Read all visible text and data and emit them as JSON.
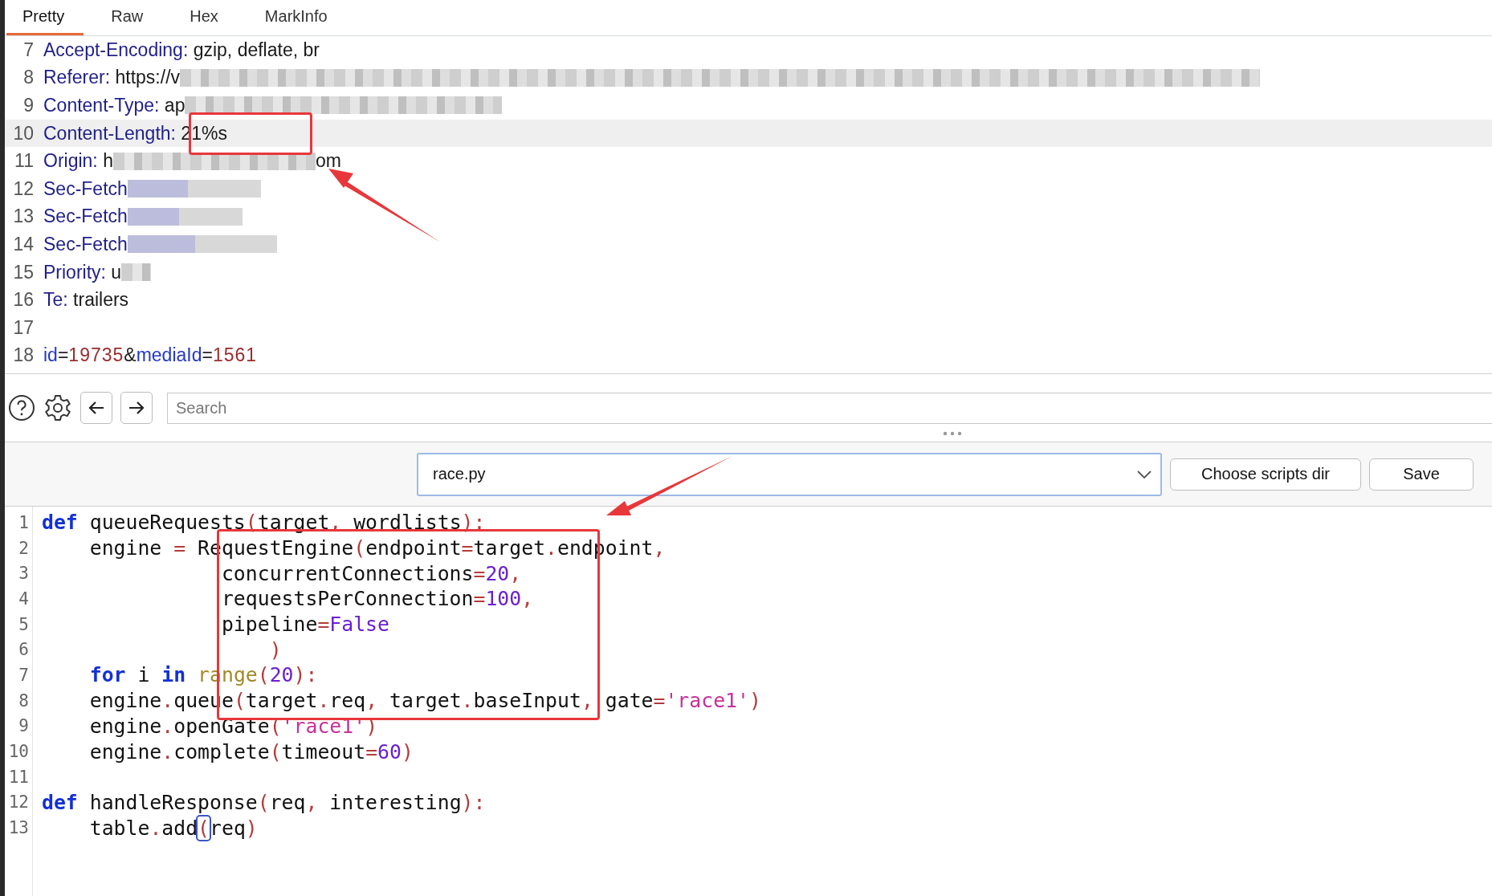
{
  "tabs": [
    {
      "label": "Pretty",
      "selected": true
    },
    {
      "label": "Raw",
      "selected": false
    },
    {
      "label": "Hex",
      "selected": false
    },
    {
      "label": "MarkInfo",
      "selected": false
    }
  ],
  "request_lines": [
    {
      "number": "7",
      "key": "Accept-Encoding:",
      "value": "gzip, deflate, br",
      "blurred": false,
      "highlighted": false
    },
    {
      "number": "8",
      "key": "Referer:",
      "value": "https://v",
      "blurred": true,
      "highlighted": false
    },
    {
      "number": "9",
      "key": "Content-Type:",
      "value": "ap",
      "blurred": true,
      "highlighted": false
    },
    {
      "number": "10",
      "key": "Content-Length:",
      "value": "21%s",
      "blurred": false,
      "highlighted": true
    },
    {
      "number": "11",
      "key": "Origin:",
      "value": "h",
      "blurred": true,
      "tail": "om",
      "highlighted": false
    },
    {
      "number": "12",
      "key": "Sec-Fetch",
      "blurred": true,
      "highlighted": false
    },
    {
      "number": "13",
      "key": "Sec-Fetch",
      "blurred": true,
      "highlighted": false
    },
    {
      "number": "14",
      "key": "Sec-Fetch",
      "blurred": true,
      "highlighted": false
    },
    {
      "number": "15",
      "key": "Priority:",
      "value": "u",
      "blurred": true,
      "highlighted": false
    },
    {
      "number": "16",
      "key": "Te:",
      "value": "trailers",
      "blurred": false,
      "highlighted": false
    },
    {
      "number": "17",
      "blurred": false,
      "highlighted": false
    }
  ],
  "body_line": {
    "number": "18",
    "parts": [
      {
        "kind": "param",
        "text": "id"
      },
      {
        "kind": "op",
        "text": "="
      },
      {
        "kind": "value",
        "text": "19735"
      },
      {
        "kind": "op",
        "text": "&"
      },
      {
        "kind": "param",
        "text": "mediaId"
      },
      {
        "kind": "op",
        "text": "="
      },
      {
        "kind": "value",
        "text": "1561"
      }
    ]
  },
  "search": {
    "placeholder": "Search"
  },
  "script": {
    "value": "race.py"
  },
  "buttons": [
    "Choose scripts dir",
    "Save"
  ],
  "code_lines": [
    {
      "number": "1",
      "parts": [
        {
          "kind": "kw",
          "text": "def"
        },
        {
          "kind": "name",
          "text": " queueRequests"
        },
        {
          "kind": "op",
          "text": "("
        },
        {
          "kind": "name",
          "text": "target"
        },
        {
          "kind": "op",
          "text": ","
        },
        {
          "kind": "name",
          "text": " wordlists"
        },
        {
          "kind": "op",
          "text": ")"
        },
        {
          "kind": "op",
          "text": ":"
        }
      ]
    },
    {
      "number": "2",
      "parts": [
        {
          "kind": "name",
          "text": "    engine "
        },
        {
          "kind": "op",
          "text": "="
        },
        {
          "kind": "name",
          "text": " RequestEngine"
        },
        {
          "kind": "op",
          "text": "("
        },
        {
          "kind": "name",
          "text": "endpoint"
        },
        {
          "kind": "op",
          "text": "="
        },
        {
          "kind": "name",
          "text": "target"
        },
        {
          "kind": "op",
          "text": "."
        },
        {
          "kind": "name",
          "text": "endpoint"
        },
        {
          "kind": "op",
          "text": ","
        }
      ]
    },
    {
      "number": "3",
      "parts": [
        {
          "kind": "name",
          "text": "               concurrentConnections"
        },
        {
          "kind": "op",
          "text": "="
        },
        {
          "kind": "num",
          "text": "20"
        },
        {
          "kind": "op",
          "text": ","
        }
      ]
    },
    {
      "number": "4",
      "parts": [
        {
          "kind": "name",
          "text": "               requestsPerConnection"
        },
        {
          "kind": "op",
          "text": "="
        },
        {
          "kind": "num",
          "text": "100"
        },
        {
          "kind": "op",
          "text": ","
        }
      ]
    },
    {
      "number": "5",
      "parts": [
        {
          "kind": "name",
          "text": "               pipeline"
        },
        {
          "kind": "op",
          "text": "="
        },
        {
          "kind": "const",
          "text": "False"
        }
      ]
    },
    {
      "number": "6",
      "parts": [
        {
          "kind": "op",
          "text": "                   )"
        }
      ]
    },
    {
      "number": "7",
      "parts": [
        {
          "kind": "kw",
          "text": "    for"
        },
        {
          "kind": "name",
          "text": " i "
        },
        {
          "kind": "kw",
          "text": "in"
        },
        {
          "kind": "builtin",
          "text": " range"
        },
        {
          "kind": "op",
          "text": "("
        },
        {
          "kind": "num",
          "text": "20"
        },
        {
          "kind": "op",
          "text": ")"
        },
        {
          "kind": "op",
          "text": ":"
        }
      ]
    },
    {
      "number": "8",
      "parts": [
        {
          "kind": "name",
          "text": "    engine"
        },
        {
          "kind": "op",
          "text": "."
        },
        {
          "kind": "name",
          "text": "queue"
        },
        {
          "kind": "op",
          "text": "("
        },
        {
          "kind": "name",
          "text": "target"
        },
        {
          "kind": "op",
          "text": "."
        },
        {
          "kind": "name",
          "text": "req"
        },
        {
          "kind": "op",
          "text": ","
        },
        {
          "kind": "name",
          "text": " target"
        },
        {
          "kind": "op",
          "text": "."
        },
        {
          "kind": "name",
          "text": "baseInput"
        },
        {
          "kind": "op",
          "text": ","
        },
        {
          "kind": "name",
          "text": " gate"
        },
        {
          "kind": "op",
          "text": "="
        },
        {
          "kind": "str",
          "text": "'race1'"
        },
        {
          "kind": "op",
          "text": ")"
        }
      ]
    },
    {
      "number": "9",
      "parts": [
        {
          "kind": "name",
          "text": "    engine"
        },
        {
          "kind": "op",
          "text": "."
        },
        {
          "kind": "name",
          "text": "openGate"
        },
        {
          "kind": "op",
          "text": "("
        },
        {
          "kind": "str",
          "text": "'race1'"
        },
        {
          "kind": "op",
          "text": ")"
        }
      ]
    },
    {
      "number": "10",
      "parts": [
        {
          "kind": "name",
          "text": "    engine"
        },
        {
          "kind": "op",
          "text": "."
        },
        {
          "kind": "name",
          "text": "complete"
        },
        {
          "kind": "op",
          "text": "("
        },
        {
          "kind": "name",
          "text": "timeout"
        },
        {
          "kind": "op",
          "text": "="
        },
        {
          "kind": "num",
          "text": "60"
        },
        {
          "kind": "op",
          "text": ")"
        }
      ]
    },
    {
      "number": "11"
    },
    {
      "number": "12",
      "parts": [
        {
          "kind": "kw",
          "text": "def"
        },
        {
          "kind": "name",
          "text": " handleResponse"
        },
        {
          "kind": "op",
          "text": "("
        },
        {
          "kind": "name",
          "text": "req"
        },
        {
          "kind": "op",
          "text": ","
        },
        {
          "kind": "name",
          "text": " interesting"
        },
        {
          "kind": "op",
          "text": ")"
        },
        {
          "kind": "op",
          "text": ":"
        }
      ]
    },
    {
      "number": "13",
      "parts": [
        {
          "kind": "name",
          "text": "    table"
        },
        {
          "kind": "op",
          "text": "."
        },
        {
          "kind": "name",
          "text": "add"
        },
        {
          "kind": "match",
          "text": "("
        },
        {
          "kind": "name",
          "text": "req"
        },
        {
          "kind": "op",
          "text": ")"
        }
      ]
    }
  ]
}
